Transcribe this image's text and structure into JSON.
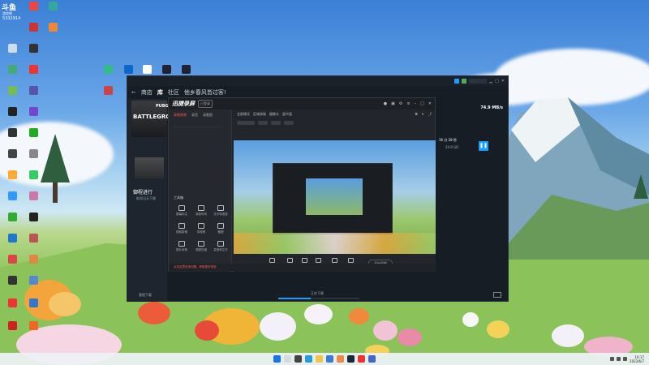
{
  "desktop": {
    "brand_logo": "斗鱼",
    "brand_sub": "游戏吧",
    "brand_room": "5332914"
  },
  "main_window": {
    "nav": {
      "back": "←",
      "store": "商店",
      "library": "库",
      "community": "社区",
      "user": "他乡春风皆过客!"
    },
    "game": {
      "logo_top": "PUBG",
      "logo_main": "BATTLEGRO"
    },
    "panel_title": "御程进行",
    "panel_sub": "取消当天下载",
    "stats_value": "74.9 MB/s",
    "time_value": "16 分 28 秒",
    "size_value": "24.9 GB",
    "bottom_left": "管理下载",
    "bottom_center": "正在下载"
  },
  "recorder": {
    "logo": "迅捷录屏",
    "badge": "已登录",
    "tabs": [
      "录制视频",
      "录音",
      "录截图"
    ],
    "tools_title": "工具箱",
    "tools": [
      "屏幕标注",
      "录制时间",
      "文字转语音",
      "视频剪辑",
      "录视频",
      "截图",
      "图片转换",
      "视频压缩",
      "录音转文字"
    ],
    "tabs_main": [
      "全屏模式",
      "区域录制",
      "摄像头",
      "画中画"
    ],
    "bottom_items": [
      "全屏录制",
      "区域录制",
      "录音",
      "摄像头",
      "系统声音",
      "麦克风"
    ],
    "record_button": "开始录制",
    "footer": "点击这里反馈问题，获取更好体验"
  },
  "taskbar": {
    "time": "10:17",
    "date": "2023/6/7"
  }
}
